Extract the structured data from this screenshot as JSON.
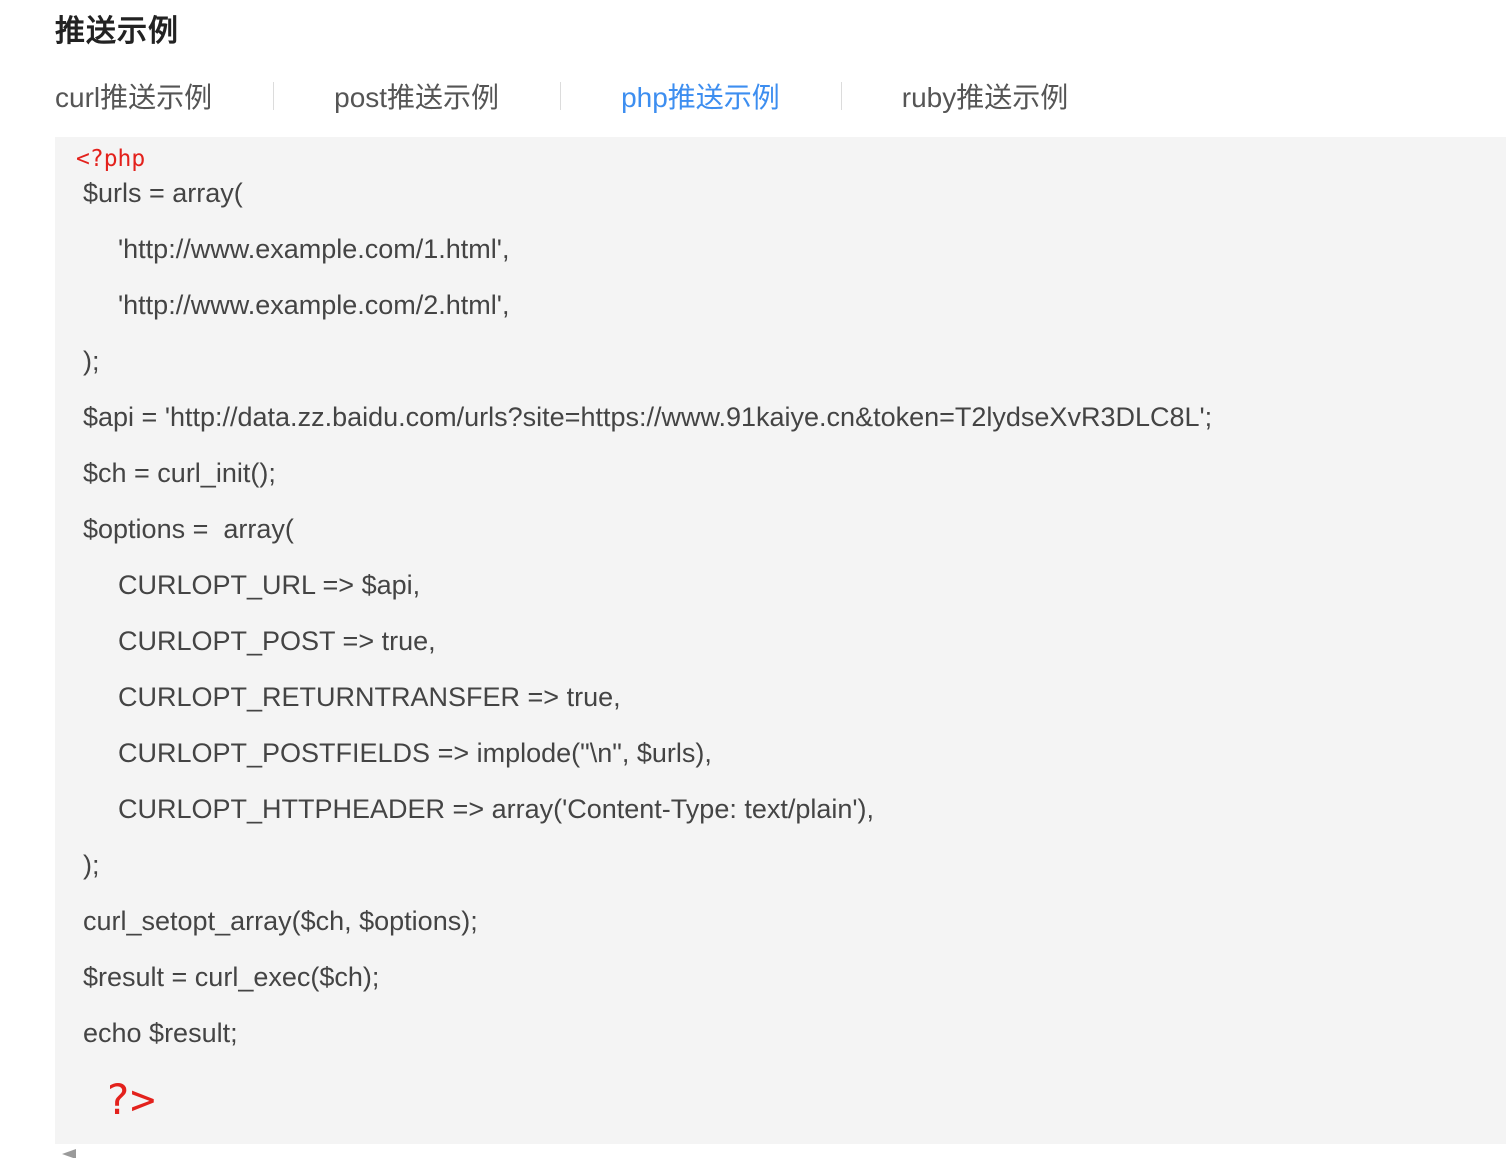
{
  "section": {
    "title": "推送示例"
  },
  "tabs": [
    {
      "label": "curl推送示例",
      "active": false
    },
    {
      "label": "post推送示例",
      "active": false
    },
    {
      "label": "php推送示例",
      "active": true
    },
    {
      "label": "ruby推送示例",
      "active": false
    }
  ],
  "colors": {
    "active_tab": "#3d8ef0",
    "tab_text": "#555555",
    "php_tag": "#e3211c",
    "code_text": "#444444",
    "code_background": "#f4f4f4"
  },
  "code": {
    "open_tag": "<?php",
    "lines": [
      "$urls = array(",
      "'http://www.example.com/1.html',",
      "'http://www.example.com/2.html',",
      ");",
      "$api = 'http://data.zz.baidu.com/urls?site=https://www.91kaiye.cn&token=T2lydseXvR3DLC8L';",
      "$ch = curl_init();",
      "$options =  array(",
      "CURLOPT_URL => $api,",
      "CURLOPT_POST => true,",
      "CURLOPT_RETURNTRANSFER => true,",
      "CURLOPT_POSTFIELDS => implode(\"\\n\", $urls),",
      "CURLOPT_HTTPHEADER => array('Content-Type: text/plain'),",
      ");",
      "curl_setopt_array($ch, $options);",
      "$result = curl_exec($ch);",
      "echo $result;"
    ],
    "close_tag": "?>"
  }
}
